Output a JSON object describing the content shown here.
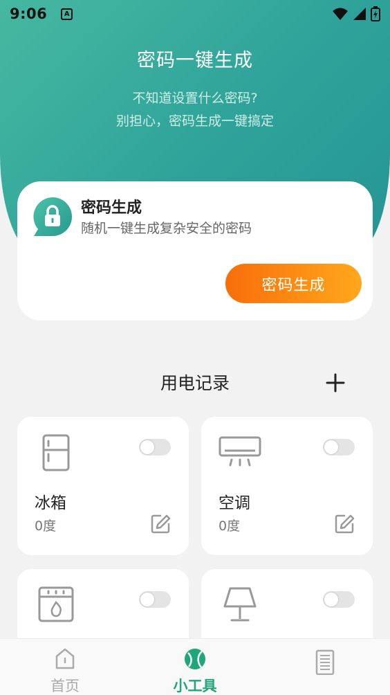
{
  "status_bar": {
    "time": "9:06",
    "notification_icon": "A"
  },
  "hero": {
    "title": "密码一键生成",
    "subtitle_line1": "不知道设置什么密码?",
    "subtitle_line2": "别担心，密码生成一键搞定"
  },
  "password_card": {
    "icon": "lock-chat-icon",
    "title": "密码生成",
    "description": "随机一键生成复杂安全的密码",
    "button_label": "密码生成"
  },
  "records": {
    "title": "用电记录",
    "add_icon": "plus-icon",
    "devices": [
      {
        "name": "冰箱",
        "usage": "0度",
        "icon": "fridge-icon",
        "enabled": false
      },
      {
        "name": "空调",
        "usage": "0度",
        "icon": "air-conditioner-icon",
        "enabled": false
      },
      {
        "name": "",
        "usage": "",
        "icon": "oven-icon",
        "enabled": false
      },
      {
        "name": "",
        "usage": "",
        "icon": "lamp-icon",
        "enabled": false
      }
    ]
  },
  "tabbar": {
    "tabs": [
      {
        "label": "首页",
        "icon": "home-icon",
        "active": false
      },
      {
        "label": "小工具",
        "icon": "tools-ball-icon",
        "active": true
      },
      {
        "label": "",
        "icon": "document-icon",
        "active": false
      }
    ]
  },
  "colors": {
    "hero_start": "#46b8a1",
    "hero_end": "#259594",
    "button_start": "#f86e0a",
    "button_end": "#ffa81c",
    "active_tab": "#1fa67a"
  }
}
